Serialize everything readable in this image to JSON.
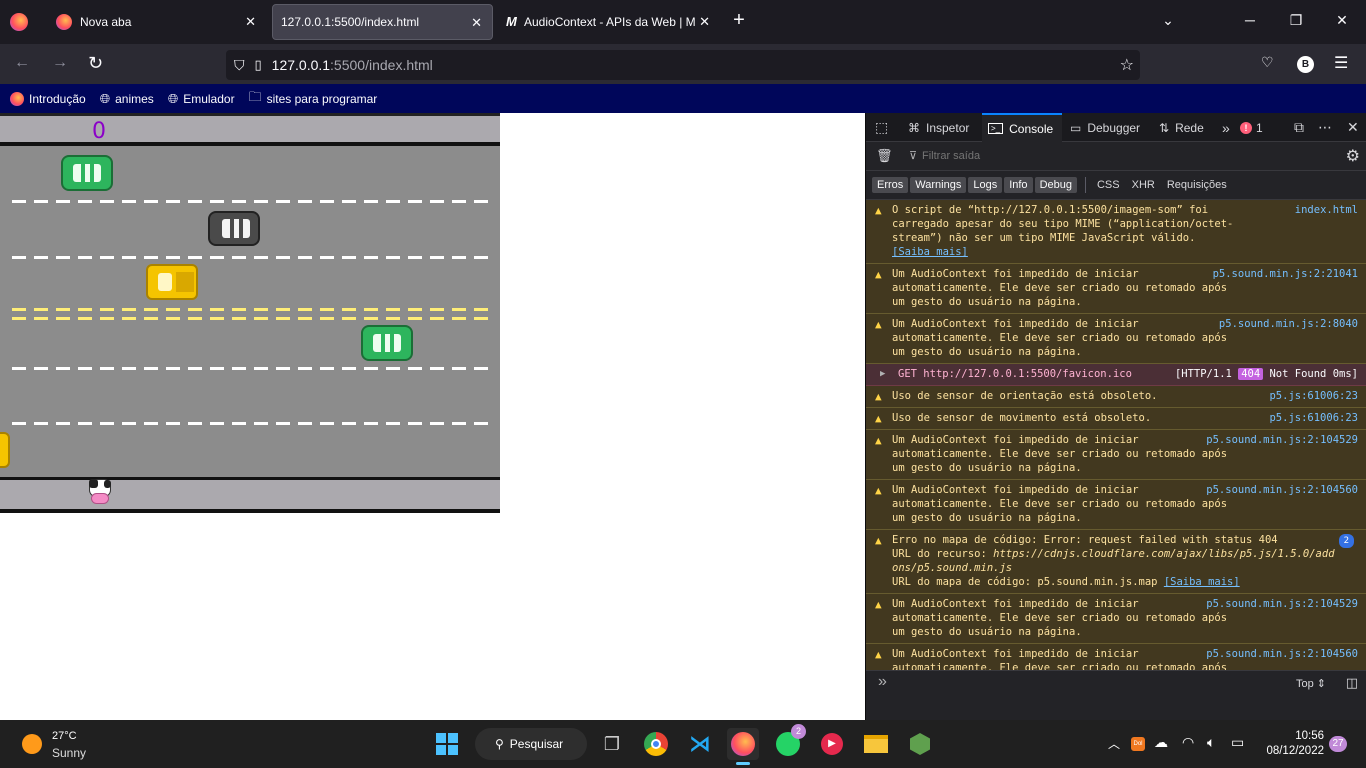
{
  "browser": {
    "tabs": [
      {
        "title": "Nova aba"
      },
      {
        "title": "127.0.0.1:5500/index.html"
      },
      {
        "title": "AudioContext - APIs da Web | M"
      }
    ],
    "new_tab": "+",
    "url_host": "127.0.0.1",
    "url_path": ":5500/index.html",
    "account_initial": "B",
    "bookmarks": [
      {
        "label": "Introdução",
        "icon": "firefox-icon"
      },
      {
        "label": "animes",
        "icon": "globe-icon"
      },
      {
        "label": "Emulador",
        "icon": "globe-icon"
      },
      {
        "label": "sites para programar",
        "icon": "folder-icon"
      }
    ]
  },
  "game": {
    "score": "0",
    "road_color": "#8c8c8c",
    "sidewalk_color": "#aba9ae",
    "score_color": "#8b00c8",
    "cars": [
      {
        "color": "green",
        "lane": 0
      },
      {
        "color": "gray",
        "lane": 1
      },
      {
        "color": "yellow",
        "lane": 2
      },
      {
        "color": "green",
        "lane": 3
      },
      {
        "color": "yellow",
        "lane": 5
      }
    ],
    "player": "cow-icon"
  },
  "devtools": {
    "tabs": [
      "Inspetor",
      "Console",
      "Debugger",
      "Rede"
    ],
    "error_count": "1",
    "filter_placeholder": "Filtrar saída",
    "log_categories": [
      "Erros",
      "Warnings",
      "Logs",
      "Info",
      "Debug"
    ],
    "request_categories": [
      "CSS",
      "XHR",
      "Requisições"
    ],
    "messages": [
      {
        "text": "O script de “http://127.0.0.1:5500/imagem-som” foi carregado apesar do seu tipo MIME (“application/octet-stream”) não ser um tipo MIME JavaScript válido. ",
        "link": "[Saiba mais]",
        "source": "index.html"
      },
      {
        "text": "Um AudioContext foi impedido de iniciar automaticamente. Ele deve ser criado ou retomado após um gesto do usuário na página.",
        "source": "p5.sound.min.js:2:21041"
      },
      {
        "text": "Um AudioContext foi impedido de iniciar automaticamente. Ele deve ser criado ou retomado após um gesto do usuário na página.",
        "source": "p5.sound.min.js:2:8040"
      }
    ],
    "request": {
      "method": "GET",
      "url": "http://127.0.0.1:5500/favicon.ico",
      "protocol": "[HTTP/1.1",
      "status": "404",
      "status_text": "Not Found 0ms]"
    },
    "messages2": [
      {
        "text": "Uso de sensor de orientação está obsoleto.",
        "source": "p5.js:61006:23"
      },
      {
        "text": "Uso de sensor de movimento está obsoleto.",
        "source": "p5.js:61006:23"
      },
      {
        "text": "Um AudioContext foi impedido de iniciar automaticamente. Ele deve ser criado ou retomado após um gesto do usuário na página.",
        "source": "p5.sound.min.js:2:104529"
      },
      {
        "text": "Um AudioContext foi impedido de iniciar automaticamente. Ele deve ser criado ou retomado após um gesto do usuário na página.",
        "source": "p5.sound.min.js:2:104560"
      }
    ],
    "sourcemap": {
      "line1": "Erro no mapa de código: Error: request failed with status 404",
      "line2_label": "URL do recurso: ",
      "line2_url": "https://cdnjs.cloudflare.com/ajax/libs/p5.js/1.5.0/addons/p5.sound.min.js",
      "line3_label": "URL do mapa de código: p5.sound.min.js.map ",
      "link": "[Saiba mais]",
      "count": "2"
    },
    "messages3": [
      {
        "text": "Um AudioContext foi impedido de iniciar automaticamente. Ele deve ser criado ou retomado após um gesto do usuário na página.",
        "source": "p5.sound.min.js:2:104529"
      },
      {
        "text": "Um AudioContext foi impedido de iniciar automaticamente. Ele deve ser criado ou retomado após um gesto do usuário na página.",
        "source": "p5.sound.min.js:2:104560"
      }
    ],
    "prompt": "»",
    "context": "Top ⇕"
  },
  "taskbar": {
    "weather_temp": "27°C",
    "weather_desc": "Sunny",
    "search_label": "Pesquisar",
    "whatsapp_badge": "2",
    "time": "10:56",
    "date": "08/12/2022",
    "notification_count": "27"
  }
}
